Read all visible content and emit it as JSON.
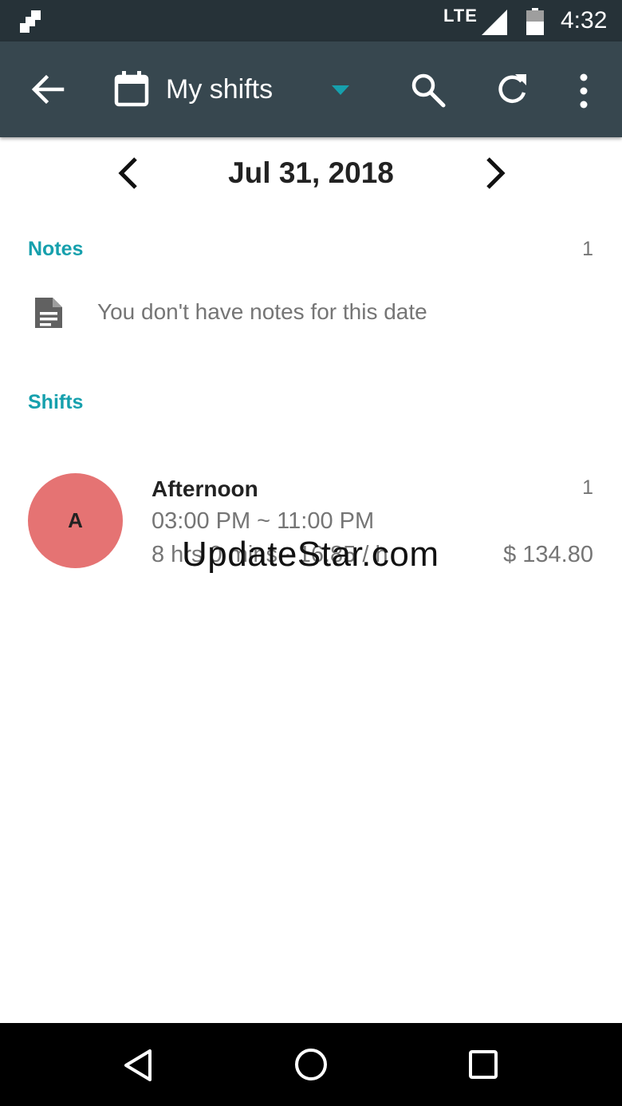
{
  "status_bar": {
    "network": "LTE",
    "time": "4:32",
    "icons": [
      "app-notification-icon",
      "signal-icon",
      "battery-icon"
    ]
  },
  "toolbar": {
    "title": "My shifts",
    "icons": [
      "back-arrow-icon",
      "calendar-icon",
      "dropdown-arrow-icon",
      "search-icon",
      "refresh-icon",
      "overflow-menu-icon"
    ],
    "accent_color": "#37474f"
  },
  "date_nav": {
    "date": "Jul 31, 2018",
    "icons": [
      "chevron-left-icon",
      "chevron-right-icon"
    ]
  },
  "notes": {
    "title": "Notes",
    "count": "1",
    "empty_message": "You don't have notes for this date",
    "icon": "note-icon"
  },
  "shifts": {
    "title": "Shifts",
    "items": [
      {
        "avatar_letter": "A",
        "avatar_color": "#e57373",
        "name": "Afternoon",
        "count": "1",
        "time": "03:00 PM ~ 11:00 PM",
        "duration": "8 hrs 0 mins · 16.85 / h",
        "total": "$ 134.80"
      }
    ]
  },
  "watermark": "UpdateStar.com",
  "section_color": "#16a0ad",
  "nav_bar": {
    "icons": [
      "nav-back-icon",
      "nav-home-icon",
      "nav-recents-icon"
    ]
  }
}
